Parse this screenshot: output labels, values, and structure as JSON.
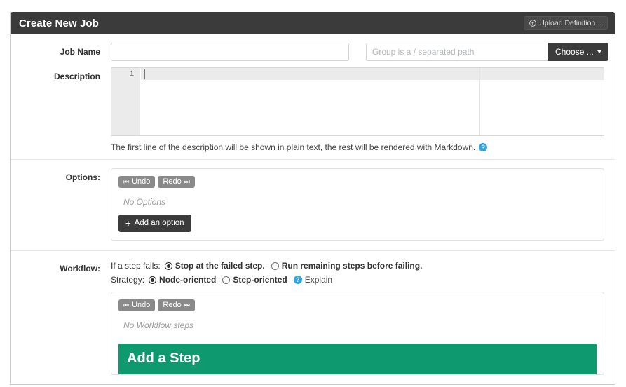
{
  "panel": {
    "title": "Create New Job",
    "upload_button": {
      "label": "Upload Definition...",
      "icon": "upload-circle-icon"
    }
  },
  "form": {
    "job_name": {
      "label": "Job Name",
      "value": "",
      "placeholder": ""
    },
    "group": {
      "value": "",
      "placeholder": "Group is a / separated path",
      "choose_button": "Choose ..."
    },
    "description": {
      "label": "Description",
      "line_number": "1",
      "value": "",
      "help_text": "The first line of the description will be shown in plain text, the rest will be rendered with Markdown.",
      "help_icon": "question-circle-icon"
    }
  },
  "options": {
    "label": "Options:",
    "undo_label": "Undo",
    "redo_label": "Redo",
    "undo_glyph": "⏮",
    "redo_glyph": "⏭",
    "empty_text": "No Options",
    "add_button": "Add an option",
    "add_icon": "plus-icon"
  },
  "workflow": {
    "label": "Workflow:",
    "failure_prompt": "If a step fails:",
    "failure_options": [
      {
        "label": "Stop at the failed step.",
        "checked": true
      },
      {
        "label": "Run remaining steps before failing.",
        "checked": false
      }
    ],
    "strategy_prompt": "Strategy:",
    "strategy_options": [
      {
        "label": "Node-oriented",
        "checked": true
      },
      {
        "label": "Step-oriented",
        "checked": false
      }
    ],
    "explain_label": "Explain",
    "explain_icon": "question-circle-icon",
    "undo_label": "Undo",
    "redo_label": "Redo",
    "undo_glyph": "⏮",
    "redo_glyph": "⏭",
    "empty_text": "No Workflow steps",
    "add_step_title": "Add a Step"
  },
  "colors": {
    "header_bg": "#3b3b3b",
    "accent_green": "#0e9a6e",
    "link_blue": "#2fa4e7",
    "button_gray": "#8a8a8a"
  }
}
